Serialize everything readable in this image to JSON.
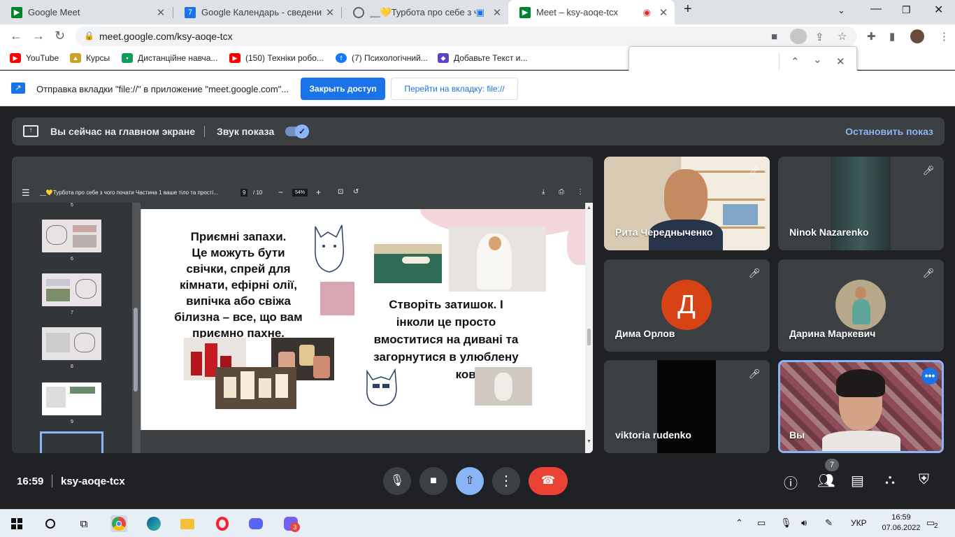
{
  "browser": {
    "tabs": [
      {
        "title": "Google Meet",
        "active": false
      },
      {
        "title": "Google Календарь - сведения о",
        "active": false
      },
      {
        "title": "__💛Турбота про себе з чо",
        "active": false
      },
      {
        "title": "Meet – ksy-aoqe-tcx",
        "active": true
      }
    ],
    "url": "meet.google.com/ksy-aoqe-tcx",
    "bookmarks": [
      {
        "label": "YouTube",
        "color": "#ff0000"
      },
      {
        "label": "Курсы",
        "color": "#c9a227"
      },
      {
        "label": "Дистанційне навча...",
        "color": "#0f9d58"
      },
      {
        "label": "(150) Техніки робо...",
        "color": "#ff0000"
      },
      {
        "label": "(7) Психологічний...",
        "color": "#1877f2"
      },
      {
        "label": "Добавьте Текст и...",
        "color": "#5f43c7"
      }
    ],
    "infobar": {
      "message": "Отправка вкладки \"file://\" в приложение \"meet.google.com\"...",
      "stop_access": "Закрыть доступ",
      "goto_tab": "Перейти на вкладку: file://"
    }
  },
  "meet": {
    "presenting_text": "Вы сейчас на главном экране",
    "sound_label": "Звук показа",
    "stop_presenting": "Остановить показ",
    "pdf": {
      "title": "__💛Турбота про себе з чого почати Частина 1 ваше тіло та прості...",
      "page": "9",
      "page_total": "/ 10",
      "zoom": "54%",
      "thumb_labels": [
        "5",
        "6",
        "7",
        "8",
        "9"
      ]
    },
    "slide": {
      "text_left": [
        "Приємні запахи.",
        "Це можуть бути",
        "свічки, спрей для",
        "кімнати, ефірні олії,",
        "випічка або свіжа",
        "білизна – все, що вам",
        "приємно пахне."
      ],
      "text_right": [
        "Створіть затишок. І",
        "інколи це просто",
        "вмоститися на дивані та",
        "загорнутися в улюблену",
        "ковдру."
      ]
    },
    "participants": [
      {
        "name": "Рита Чередныченко",
        "muted": true
      },
      {
        "name": "Ninok Nazarenko",
        "muted": true
      },
      {
        "name": "Дима Орлов",
        "muted": true,
        "initial": "Д",
        "avatar_color": "#d84315"
      },
      {
        "name": "Дарина Маркевич",
        "muted": true
      },
      {
        "name": "viktoria rudenko",
        "muted": true
      },
      {
        "name": "Вы",
        "muted": false
      }
    ],
    "time": "16:59",
    "meeting_code": "ksy-aoqe-tcx",
    "people_count": "7"
  },
  "taskbar": {
    "lang": "УКР",
    "clock_time": "16:59",
    "clock_date": "07.06.2022",
    "notifications": "2",
    "viber_badge": "3"
  }
}
